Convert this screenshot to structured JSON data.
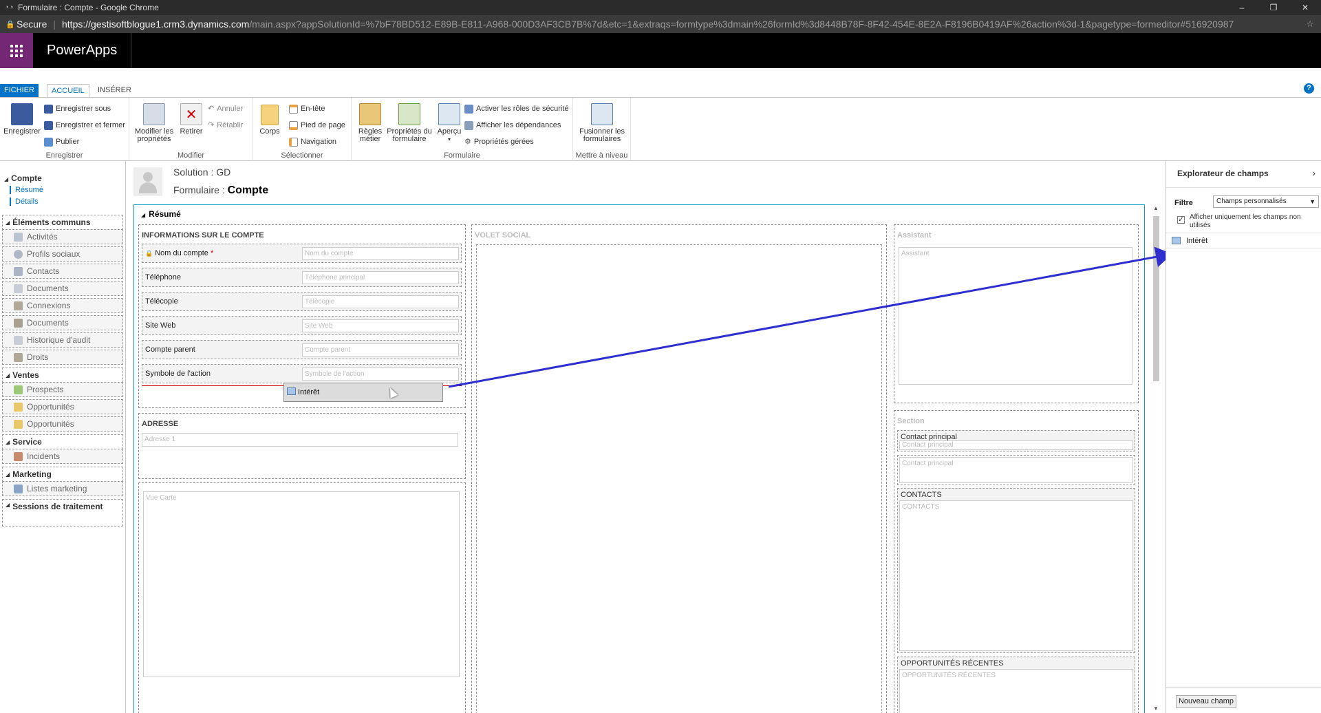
{
  "browser": {
    "title": "Formulaire : Compte - Google Chrome",
    "secure_label": "Secure",
    "url_host": "https://gestisoftblogue1.crm3.dynamics.com",
    "url_rest": "/main.aspx?appSolutionId=%7bF78BD512-E89B-E811-A968-000D3AF3CB7B%7d&etc=1&extraqs=formtype%3dmain%26formId%3d8448B78F-8F42-454E-8E2A-F8196B0419AF%26action%3d-1&pagetype=formeditor#516920987"
  },
  "app": {
    "name": "PowerApps"
  },
  "ribbon": {
    "tabs": [
      "FICHIER",
      "ACCUEIL",
      "INSÉRER"
    ],
    "save": {
      "enregistrer": "Enregistrer",
      "enregistrer_sous": "Enregistrer sous",
      "enregistrer_fermer": "Enregistrer et fermer",
      "publier": "Publier",
      "group": "Enregistrer"
    },
    "modify": {
      "modifier_line1": "Modifier les",
      "modifier_line2": "propriétés",
      "retirer": "Retirer",
      "annuler": "Annuler",
      "retablir": "Rétablir",
      "group": "Modifier"
    },
    "select": {
      "corps": "Corps",
      "entete": "En-tête",
      "pied": "Pied de page",
      "navigation": "Navigation",
      "group": "Sélectionner"
    },
    "form": {
      "regles_line1": "Règles",
      "regles_line2": "métier",
      "props_line1": "Propriétés du",
      "props_line2": "formulaire",
      "apercu": "Aperçu",
      "activer": "Activer les rôles de sécurité",
      "afficher": "Afficher les dépendances",
      "gerees": "Propriétés gérées",
      "group": "Formulaire"
    },
    "upgrade": {
      "fusionner_line1": "Fusionner les",
      "fusionner_line2": "formulaires",
      "group": "Mettre à niveau"
    }
  },
  "nav": {
    "compte": "Compte",
    "resume": "Résumé",
    "details": "Détails",
    "elements_communs": "Éléments communs",
    "items_common": [
      "Activités",
      "Profils sociaux",
      "Contacts",
      "Documents",
      "Connexions",
      "Documents",
      "Historique d'audit",
      "Droits"
    ],
    "ventes": "Ventes",
    "items_ventes": [
      "Prospects",
      "Opportunités",
      "Opportunités"
    ],
    "service": "Service",
    "items_service": [
      "Incidents"
    ],
    "marketing": "Marketing",
    "items_marketing": [
      "Listes marketing"
    ],
    "sessions": "Sessions de traitement"
  },
  "header": {
    "solution_label": "Solution : ",
    "solution_value": "GD",
    "form_label": "Formulaire : ",
    "form_value": "Compte"
  },
  "form": {
    "tab_title": "Résumé",
    "section_info": "INFORMATIONS SUR LE COMPTE",
    "fields": [
      {
        "label": "Nom du compte",
        "placeholder": "Nom du compte"
      },
      {
        "label": "Téléphone",
        "placeholder": "Téléphone principal"
      },
      {
        "label": "Télécopie",
        "placeholder": "Télécopie"
      },
      {
        "label": "Site Web",
        "placeholder": "Site Web"
      },
      {
        "label": "Compte parent",
        "placeholder": "Compte parent"
      },
      {
        "label": "Symbole de l'action",
        "placeholder": "Symbole de l'action"
      }
    ],
    "drag_field": "Intérêt",
    "section_adresse": "ADRESSE",
    "adresse_placeholder": "Adresse 1",
    "vue_carte": "Vue Carte",
    "volet_social": "VOLET SOCIAL",
    "assistant_label": "Assistant",
    "assistant_placeholder": "Assistant",
    "section_label": "Section",
    "contact_principal_label": "Contact principal",
    "contact_principal_placeholder": "Contact principal",
    "contact_principal_ghost": "Contact principal",
    "contacts_label": "CONTACTS",
    "contacts_placeholder": "CONTACTS",
    "opps_label": "OPPORTUNITÉS RÉCENTES",
    "opps_placeholder": "OPPORTUNITÉS RÉCENTES"
  },
  "explorer": {
    "title": "Explorateur de champs",
    "filter_label": "Filtre",
    "filter_value": "Champs personnalisés",
    "checkbox_label": "Afficher uniquement les champs non utilisés",
    "checkbox_checked": true,
    "fields": [
      "Intérêt"
    ],
    "new_button": "Nouveau champ"
  },
  "colors": {
    "accent": "#0072c6",
    "powerapps": "#742774",
    "arrow": "#2f2fd0",
    "drop": "#cc0000"
  }
}
